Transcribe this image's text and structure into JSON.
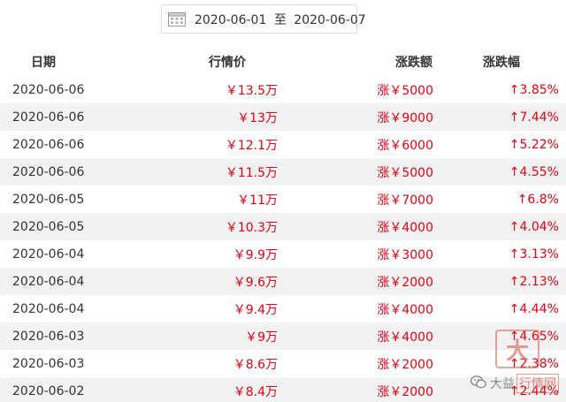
{
  "date_range": {
    "start": "2020-06-01",
    "separator": "至",
    "end": "2020-06-07",
    "icon": "calendar-icon"
  },
  "table": {
    "headers": {
      "date": "日期",
      "price": "行情价",
      "change": "涨跌额",
      "pct": "涨跌幅"
    },
    "rows": [
      {
        "date": "2020-06-06",
        "price": "￥13.5万",
        "change": "涨￥5000",
        "pct": "↑3.85%"
      },
      {
        "date": "2020-06-06",
        "price": "￥13万",
        "change": "涨￥9000",
        "pct": "↑7.44%"
      },
      {
        "date": "2020-06-06",
        "price": "￥12.1万",
        "change": "涨￥6000",
        "pct": "↑5.22%"
      },
      {
        "date": "2020-06-06",
        "price": "￥11.5万",
        "change": "涨￥5000",
        "pct": "↑4.55%"
      },
      {
        "date": "2020-06-05",
        "price": "￥11万",
        "change": "涨￥7000",
        "pct": "↑6.8%"
      },
      {
        "date": "2020-06-05",
        "price": "￥10.3万",
        "change": "涨￥4000",
        "pct": "↑4.04%"
      },
      {
        "date": "2020-06-04",
        "price": "￥9.9万",
        "change": "涨￥3000",
        "pct": "↑3.13%"
      },
      {
        "date": "2020-06-04",
        "price": "￥9.6万",
        "change": "涨￥2000",
        "pct": "↑2.13%"
      },
      {
        "date": "2020-06-04",
        "price": "￥9.4万",
        "change": "涨￥4000",
        "pct": "↑4.44%"
      },
      {
        "date": "2020-06-03",
        "price": "￥9万",
        "change": "涨￥4000",
        "pct": "↑4.65%"
      },
      {
        "date": "2020-06-03",
        "price": "￥8.6万",
        "change": "涨￥2000",
        "pct": "↑2.38%"
      },
      {
        "date": "2020-06-02",
        "price": "￥8.4万",
        "change": "涨￥2000",
        "pct": "↑2.44%"
      }
    ]
  },
  "watermark": {
    "logo_char": "大",
    "text_prefix": "大益",
    "text_highlight": "行情网",
    "icon": "wechat-icon"
  },
  "colors": {
    "rise": "#e60012",
    "stripe": "#f2f2f2",
    "text": "#333333"
  }
}
